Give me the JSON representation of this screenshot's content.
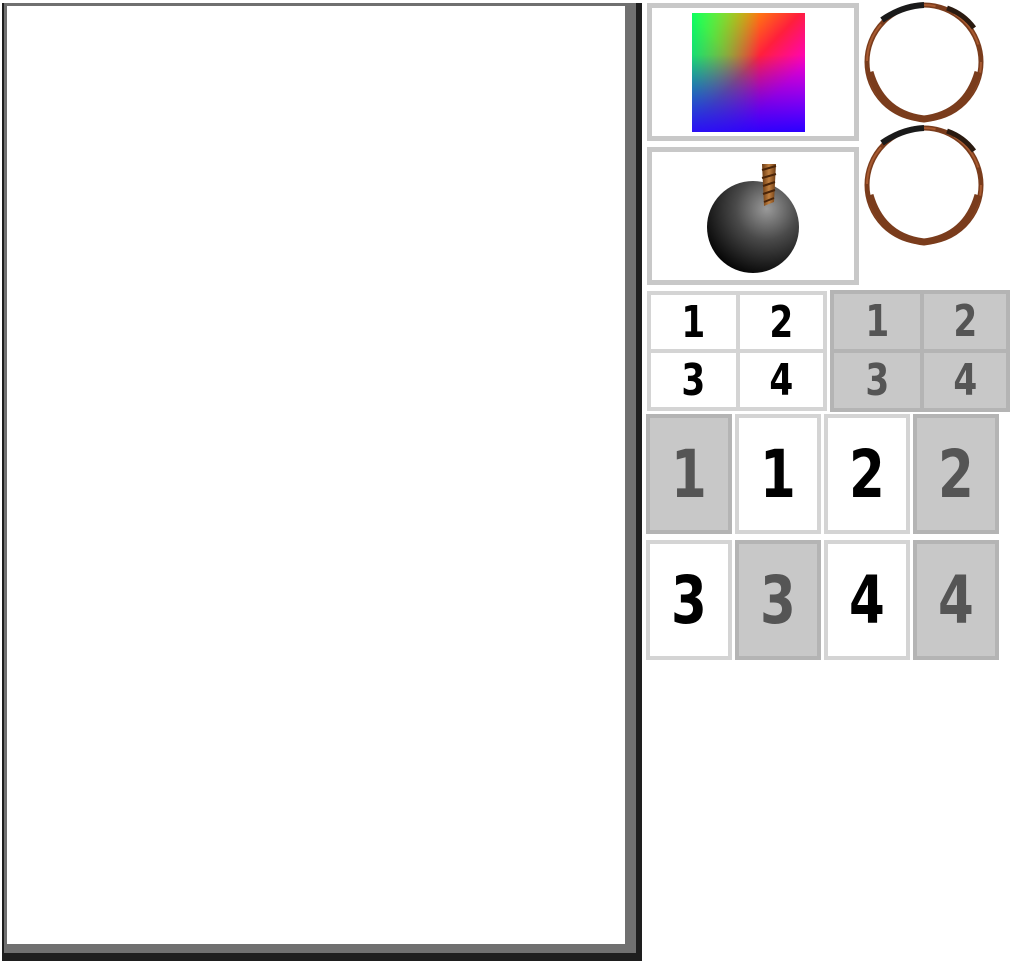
{
  "board": {
    "label": ""
  },
  "palette": {
    "small_light": [
      "1",
      "2",
      "3",
      "4"
    ],
    "small_dark": [
      "1",
      "2",
      "3",
      "4"
    ],
    "big_row1": [
      {
        "label": "1",
        "style": "dark"
      },
      {
        "label": "1",
        "style": "light"
      },
      {
        "label": "2",
        "style": "light"
      },
      {
        "label": "2",
        "style": "dark"
      }
    ],
    "big_row2": [
      {
        "label": "3",
        "style": "light"
      },
      {
        "label": "3",
        "style": "dark"
      },
      {
        "label": "4",
        "style": "light"
      },
      {
        "label": "4",
        "style": "dark"
      }
    ]
  },
  "colors": {
    "frame_outer": "#1e1e1e",
    "frame_mid": "#707070",
    "tile_light_bg": "#ffffff",
    "tile_dark_bg": "#c8c8c8",
    "tile_dark_text": "#555555",
    "ring": "#7a3c1c"
  },
  "icons": [
    "color-gradient-icon",
    "ring-icon",
    "bomb-icon"
  ]
}
